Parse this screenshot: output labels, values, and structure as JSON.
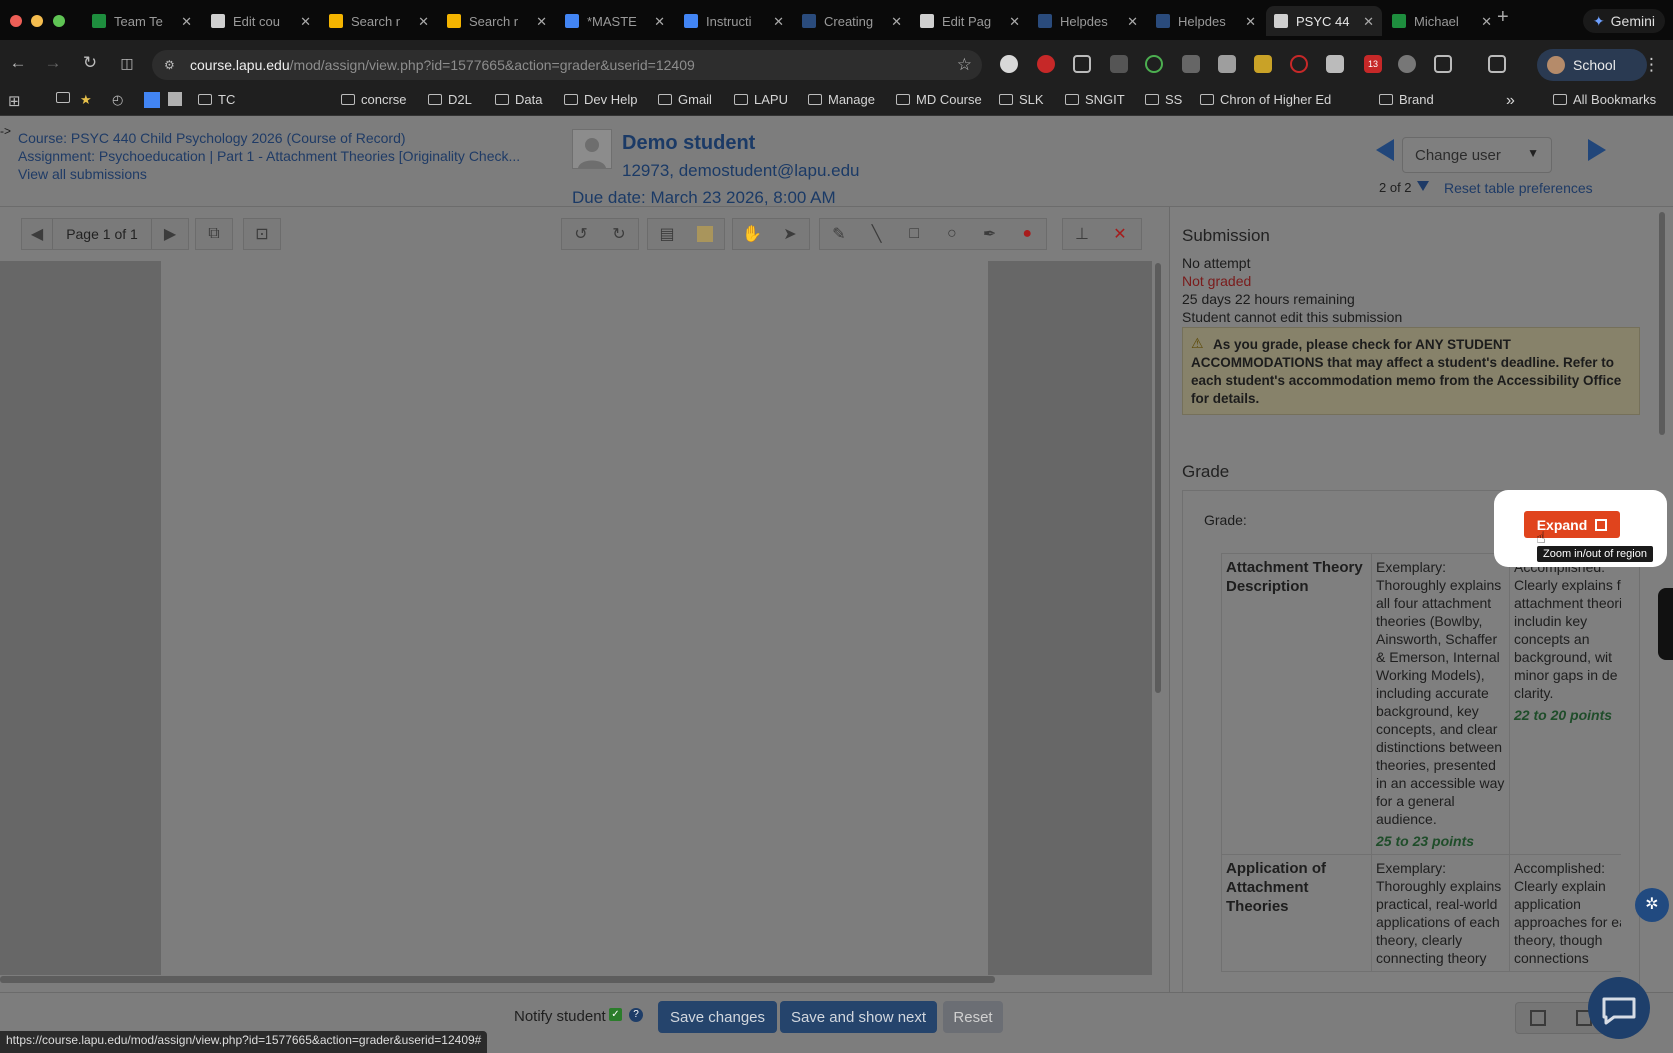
{
  "browser": {
    "tabs": [
      {
        "label": "Team Te",
        "color": "#1e8e3e"
      },
      {
        "label": "Edit cou",
        "color": "#cfcfcf"
      },
      {
        "label": "Search r",
        "color": "#f4b400"
      },
      {
        "label": "Search r",
        "color": "#f4b400"
      },
      {
        "label": "*MASTE",
        "color": "#4285f4"
      },
      {
        "label": "Instructi",
        "color": "#4285f4"
      },
      {
        "label": "Creating",
        "color": "#2a4b7c"
      },
      {
        "label": "Edit Pag",
        "color": "#cfcfcf"
      },
      {
        "label": "Helpdes",
        "color": "#2a4b7c"
      },
      {
        "label": "Helpdes",
        "color": "#2a4b7c"
      },
      {
        "label": "PSYC 44",
        "color": "#cfcfcf"
      },
      {
        "label": "Michael",
        "color": "#1e8e3e"
      }
    ],
    "gemini_label": "Gemini",
    "url_host": "course.lapu.edu",
    "url_path": "/mod/assign/view.php?id=1577665&action=grader&userid=12409",
    "profile_label": "School",
    "ext_badge": "13",
    "bookmarks": [
      "TC",
      "concrse",
      "D2L",
      "Data",
      "Dev Help",
      "Gmail",
      "LAPU",
      "Manage",
      "MD Course",
      "SLK",
      "SNGIT",
      "SS",
      "Chron of Higher Ed",
      "Brand"
    ],
    "all_bookmarks": "All Bookmarks"
  },
  "header": {
    "arrow": "->",
    "course": "Course: PSYC 440 Child Psychology 2026 (Course of Record)",
    "assignment": "Assignment: Psychoeducation | Part 1 - Attachment Theories [Originality Check...",
    "view_all": "View all submissions",
    "student_name": "Demo student",
    "student_info": "12973, demostudent@lapu.edu",
    "due_date": "Due date: March 23 2026, 8:00 AM",
    "change_user": "Change user",
    "pager": "2 of 2",
    "reset_prefs": "Reset table preferences"
  },
  "pdf": {
    "page_label": "Page 1 of 1"
  },
  "submission": {
    "title": "Submission",
    "status": "No attempt",
    "grading": "Not graded",
    "remaining": "25 days 22 hours remaining",
    "edit": "Student cannot edit this submission",
    "notice": "As you grade, please check for ANY STUDENT ACCOMMODATIONS that may affect a student's deadline. Refer to each student's accommodation memo from the Accessibility Office for details."
  },
  "grade": {
    "title": "Grade",
    "label": "Grade:",
    "expand": "Expand",
    "tooltip": "Zoom in/out of region"
  },
  "rubric": {
    "rows": [
      {
        "criterion": "Attachment Theory Description",
        "level1": "Exemplary: Thoroughly explains all four attachment theories (Bowlby, Ainsworth, Schaffer & Emerson, Internal Working Models), including accurate background, key concepts, and clear distinctions between theories, presented in an accessible way for a general audience.",
        "level1_points": "25 to 23 points",
        "level2": "Accomplished: Clearly explains four attachment theories, includin key concepts an background, wit minor gaps in de or clarity.",
        "level2_points": "22 to 20 points"
      },
      {
        "criterion": "Application of Attachment Theories",
        "level1": "Exemplary: Thoroughly explains practical, real-world applications of each theory, clearly connecting theory",
        "level2": "Accomplished: Clearly explain application approaches for each theory, though connections"
      }
    ]
  },
  "footer": {
    "notify": "Notify student",
    "save": "Save changes",
    "save_next": "Save and show next",
    "reset": "Reset",
    "status_url": "https://course.lapu.edu/mod/assign/view.php?id=1577665&action=grader&userid=12409#"
  }
}
